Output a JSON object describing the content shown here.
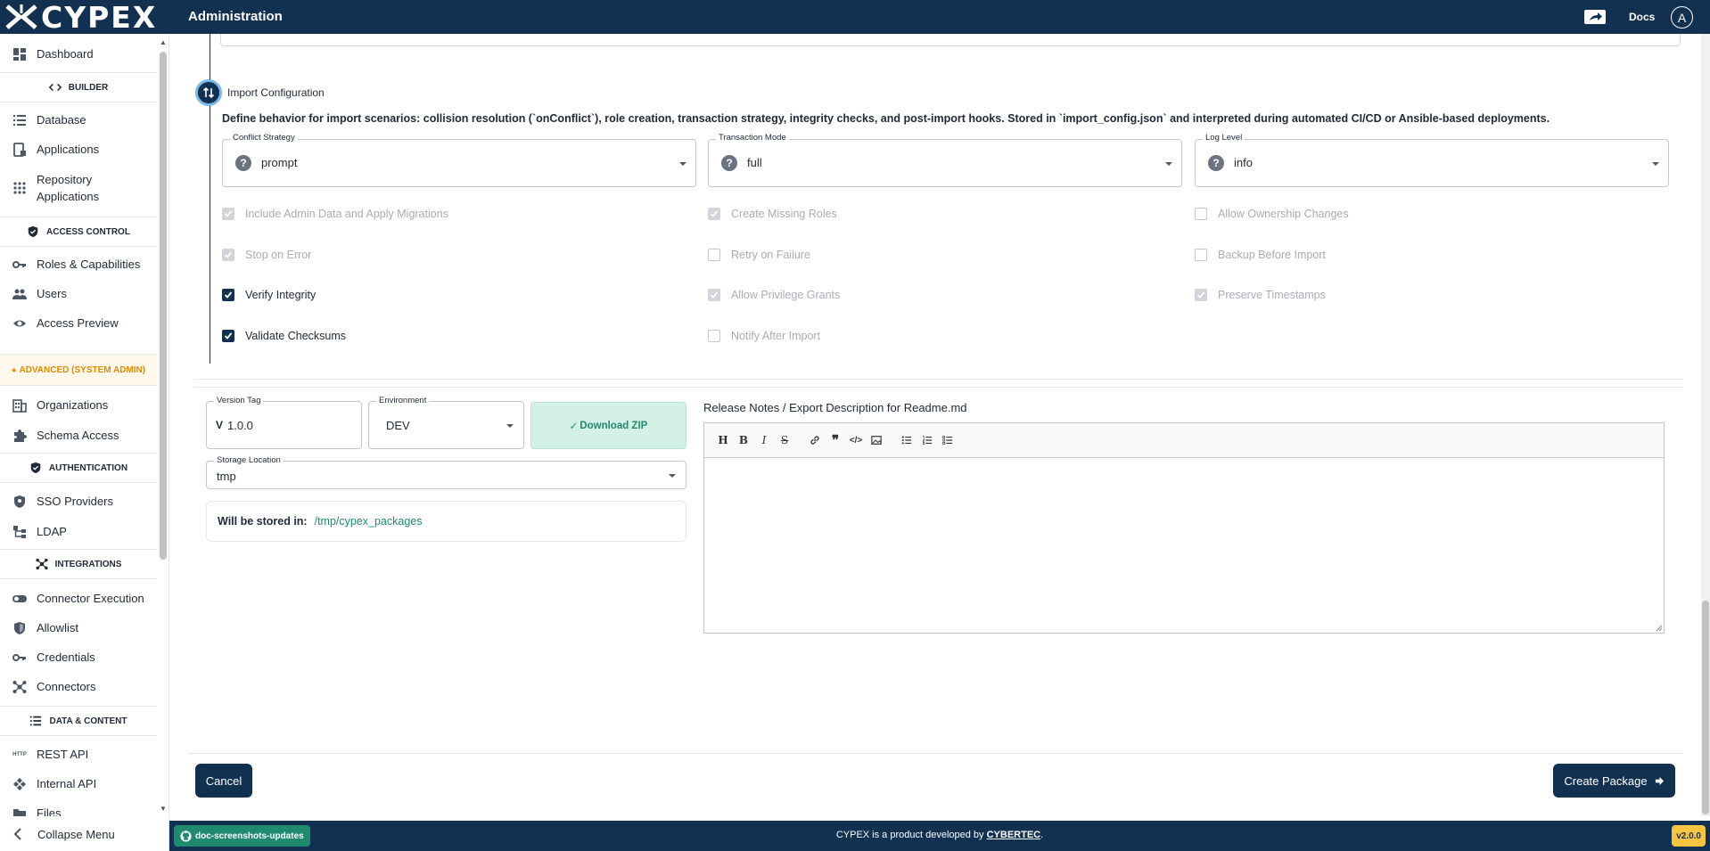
{
  "app": {
    "name": "CYPEX",
    "page_title": "Administration",
    "docs_label": "Docs",
    "avatar_letter": "A"
  },
  "sidebar": {
    "dashboard": "Dashboard",
    "sections": {
      "builder": "BUILDER",
      "access_control": "ACCESS CONTROL",
      "advanced": "ADVANCED (SYSTEM ADMIN)",
      "authentication": "AUTHENTICATION",
      "integrations": "INTEGRATIONS",
      "data_content": "DATA & CONTENT"
    },
    "items": {
      "database": "Database",
      "applications": "Applications",
      "repository_line1": "Repository",
      "repository_line2": "Applications",
      "roles": "Roles & Capabilities",
      "users": "Users",
      "access_preview": "Access Preview",
      "organizations": "Organizations",
      "schema_access": "Schema Access",
      "sso": "SSO Providers",
      "ldap": "LDAP",
      "connector_execution": "Connector Execution",
      "allowlist": "Allowlist",
      "credentials": "Credentials",
      "connectors": "Connectors",
      "rest_api": "REST API",
      "rest_api_icon_text": "HTTP",
      "internal_api": "Internal API",
      "files": "Files"
    },
    "collapse": "Collapse Menu"
  },
  "import_config": {
    "title": "Import Configuration",
    "description": "Define behavior for import scenarios: collision resolution (`onConflict`), role creation, transaction strategy, integrity checks, and post-import hooks. Stored in `import_config.json` and interpreted during automated CI/CD or Ansible-based deployments.",
    "conflict_strategy": {
      "label": "Conflict Strategy",
      "value": "prompt"
    },
    "transaction_mode": {
      "label": "Transaction Mode",
      "value": "full"
    },
    "log_level": {
      "label": "Log Level",
      "value": "info"
    },
    "checkboxes": {
      "include_admin": {
        "label": "Include Admin Data and Apply Migrations",
        "checked": true,
        "disabled": true
      },
      "create_roles": {
        "label": "Create Missing Roles",
        "checked": true,
        "disabled": true
      },
      "allow_ownership": {
        "label": "Allow Ownership Changes",
        "checked": false,
        "disabled": true
      },
      "stop_on_error": {
        "label": "Stop on Error",
        "checked": true,
        "disabled": true
      },
      "retry_on_failure": {
        "label": "Retry on Failure",
        "checked": false,
        "disabled": true
      },
      "backup_before": {
        "label": "Backup Before Import",
        "checked": false,
        "disabled": true
      },
      "verify_integrity": {
        "label": "Verify Integrity",
        "checked": true,
        "disabled": false
      },
      "allow_privilege": {
        "label": "Allow Privilege Grants",
        "checked": true,
        "disabled": true
      },
      "preserve_timestamps": {
        "label": "Preserve Timestamps",
        "checked": true,
        "disabled": true
      },
      "validate_checksums": {
        "label": "Validate Checksums",
        "checked": true,
        "disabled": false
      },
      "notify_after": {
        "label": "Notify After Import",
        "checked": false,
        "disabled": true
      }
    }
  },
  "package": {
    "version_tag": {
      "label": "Version Tag",
      "prefix": "V",
      "value": "1.0.0"
    },
    "environment": {
      "label": "Environment",
      "value": "DEV"
    },
    "download_zip": "Download ZIP",
    "storage_location": {
      "label": "Storage Location",
      "value": "tmp"
    },
    "stored_in": {
      "label": "Will be stored in:",
      "value": "/tmp/cypex_packages"
    },
    "release_notes_label": "Release Notes / Export Description for Readme.md",
    "editor_toolbar": [
      "H",
      "B",
      "I",
      "S",
      "link",
      "quote",
      "code",
      "image",
      "bullet-list",
      "numbered-list",
      "task-list"
    ]
  },
  "actions": {
    "cancel": "Cancel",
    "create_package": "Create Package"
  },
  "footer": {
    "branch": "doc-screenshots-updates",
    "text_prefix": "CYPEX is a product developed by ",
    "company": "CYBERTEC",
    "text_suffix": ".",
    "version": "v2.0.0"
  },
  "colors": {
    "navy": "#12304f",
    "teal": "#1f8a70",
    "mint": "#d4f1e6",
    "orange": "#e08a00",
    "yellow": "#f5c542"
  }
}
